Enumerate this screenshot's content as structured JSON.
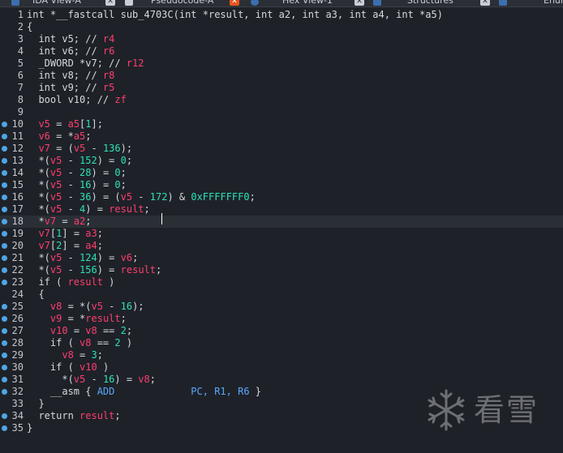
{
  "tabs": [
    {
      "label": "IDA View-A"
    },
    {
      "label": "Pseudocode-A"
    },
    {
      "label": "Hex View-1"
    },
    {
      "label": "Structures"
    },
    {
      "label": "Enum"
    }
  ],
  "code": {
    "lines": [
      {
        "n": "1",
        "bp": false,
        "t": [
          [
            "int *__fastcall sub_4703C(int *result, int a2, int a3, int a4, int *a5)",
            "k"
          ]
        ]
      },
      {
        "n": "2",
        "bp": false,
        "t": [
          [
            "{",
            "k"
          ]
        ]
      },
      {
        "n": "3",
        "bp": false,
        "t": [
          [
            "  int v5; // ",
            "k"
          ],
          [
            "r4",
            "cr"
          ]
        ]
      },
      {
        "n": "4",
        "bp": false,
        "t": [
          [
            "  int v6; // ",
            "k"
          ],
          [
            "r6",
            "cr"
          ]
        ]
      },
      {
        "n": "5",
        "bp": false,
        "t": [
          [
            "  _DWORD *v7; // ",
            "k"
          ],
          [
            "r12",
            "cr"
          ]
        ]
      },
      {
        "n": "6",
        "bp": false,
        "t": [
          [
            "  int v8; // ",
            "k"
          ],
          [
            "r8",
            "cr"
          ]
        ]
      },
      {
        "n": "7",
        "bp": false,
        "t": [
          [
            "  int v9; // ",
            "k"
          ],
          [
            "r5",
            "cr"
          ]
        ]
      },
      {
        "n": "8",
        "bp": false,
        "t": [
          [
            "  bool v10; // ",
            "k"
          ],
          [
            "zf",
            "cr"
          ]
        ]
      },
      {
        "n": "9",
        "bp": false,
        "t": [
          [
            "",
            "k"
          ]
        ]
      },
      {
        "n": "10",
        "bp": true,
        "t": [
          [
            "  ",
            "k"
          ],
          [
            "v5",
            "v"
          ],
          [
            " = ",
            "k"
          ],
          [
            "a5",
            "v"
          ],
          [
            "[",
            "k"
          ],
          [
            "1",
            "n"
          ],
          [
            "];",
            "k"
          ]
        ]
      },
      {
        "n": "11",
        "bp": true,
        "t": [
          [
            "  ",
            "k"
          ],
          [
            "v6",
            "v"
          ],
          [
            " = *",
            "k"
          ],
          [
            "a5",
            "v"
          ],
          [
            ";",
            "k"
          ]
        ]
      },
      {
        "n": "12",
        "bp": true,
        "t": [
          [
            "  ",
            "k"
          ],
          [
            "v7",
            "v"
          ],
          [
            " = (",
            "k"
          ],
          [
            "v5",
            "v"
          ],
          [
            " - ",
            "k"
          ],
          [
            "136",
            "n"
          ],
          [
            ");",
            "k"
          ]
        ]
      },
      {
        "n": "13",
        "bp": true,
        "t": [
          [
            "  *(",
            "k"
          ],
          [
            "v5",
            "v"
          ],
          [
            " - ",
            "k"
          ],
          [
            "152",
            "n"
          ],
          [
            ") = ",
            "k"
          ],
          [
            "0",
            "n"
          ],
          [
            ";",
            "k"
          ]
        ]
      },
      {
        "n": "14",
        "bp": true,
        "t": [
          [
            "  *(",
            "k"
          ],
          [
            "v5",
            "v"
          ],
          [
            " - ",
            "k"
          ],
          [
            "28",
            "n"
          ],
          [
            ") = ",
            "k"
          ],
          [
            "0",
            "n"
          ],
          [
            ";",
            "k"
          ]
        ]
      },
      {
        "n": "15",
        "bp": true,
        "t": [
          [
            "  *(",
            "k"
          ],
          [
            "v5",
            "v"
          ],
          [
            " - ",
            "k"
          ],
          [
            "16",
            "n"
          ],
          [
            ") = ",
            "k"
          ],
          [
            "0",
            "n"
          ],
          [
            ";",
            "k"
          ]
        ]
      },
      {
        "n": "16",
        "bp": true,
        "t": [
          [
            "  *(",
            "k"
          ],
          [
            "v5",
            "v"
          ],
          [
            " - ",
            "k"
          ],
          [
            "36",
            "n"
          ],
          [
            ") = (",
            "k"
          ],
          [
            "v5",
            "v"
          ],
          [
            " - ",
            "k"
          ],
          [
            "172",
            "n"
          ],
          [
            ") & ",
            "k"
          ],
          [
            "0xFFFFFFF0",
            "n"
          ],
          [
            ";",
            "k"
          ]
        ]
      },
      {
        "n": "17",
        "bp": true,
        "t": [
          [
            "  *(",
            "k"
          ],
          [
            "v5",
            "v"
          ],
          [
            " - ",
            "k"
          ],
          [
            "4",
            "n"
          ],
          [
            ") = ",
            "k"
          ],
          [
            "result",
            "v"
          ],
          [
            ";",
            "k"
          ]
        ]
      },
      {
        "n": "18",
        "bp": true,
        "current": true,
        "t": [
          [
            "  *",
            "k"
          ],
          [
            "v7",
            "v"
          ],
          [
            " = ",
            "k"
          ],
          [
            "a2",
            "v"
          ],
          [
            ";",
            "k"
          ]
        ]
      },
      {
        "n": "19",
        "bp": true,
        "t": [
          [
            "  ",
            "k"
          ],
          [
            "v7",
            "v"
          ],
          [
            "[",
            "k"
          ],
          [
            "1",
            "n"
          ],
          [
            "] = ",
            "k"
          ],
          [
            "a3",
            "v"
          ],
          [
            ";",
            "k"
          ]
        ]
      },
      {
        "n": "20",
        "bp": true,
        "t": [
          [
            "  ",
            "k"
          ],
          [
            "v7",
            "v"
          ],
          [
            "[",
            "k"
          ],
          [
            "2",
            "n"
          ],
          [
            "] = ",
            "k"
          ],
          [
            "a4",
            "v"
          ],
          [
            ";",
            "k"
          ]
        ]
      },
      {
        "n": "21",
        "bp": true,
        "t": [
          [
            "  *(",
            "k"
          ],
          [
            "v5",
            "v"
          ],
          [
            " - ",
            "k"
          ],
          [
            "124",
            "n"
          ],
          [
            ") = ",
            "k"
          ],
          [
            "v6",
            "v"
          ],
          [
            ";",
            "k"
          ]
        ]
      },
      {
        "n": "22",
        "bp": true,
        "t": [
          [
            "  *(",
            "k"
          ],
          [
            "v5",
            "v"
          ],
          [
            " - ",
            "k"
          ],
          [
            "156",
            "n"
          ],
          [
            ") = ",
            "k"
          ],
          [
            "result",
            "v"
          ],
          [
            ";",
            "k"
          ]
        ]
      },
      {
        "n": "23",
        "bp": true,
        "t": [
          [
            "  if ( ",
            "k"
          ],
          [
            "result",
            "v"
          ],
          [
            " )",
            "k"
          ]
        ]
      },
      {
        "n": "24",
        "bp": false,
        "t": [
          [
            "  {",
            "k"
          ]
        ]
      },
      {
        "n": "25",
        "bp": true,
        "t": [
          [
            "    ",
            "k"
          ],
          [
            "v8",
            "v"
          ],
          [
            " = *(",
            "k"
          ],
          [
            "v5",
            "v"
          ],
          [
            " - ",
            "k"
          ],
          [
            "16",
            "n"
          ],
          [
            ");",
            "k"
          ]
        ]
      },
      {
        "n": "26",
        "bp": true,
        "t": [
          [
            "    ",
            "k"
          ],
          [
            "v9",
            "v"
          ],
          [
            " = *",
            "k"
          ],
          [
            "result",
            "v"
          ],
          [
            ";",
            "k"
          ]
        ]
      },
      {
        "n": "27",
        "bp": true,
        "t": [
          [
            "    ",
            "k"
          ],
          [
            "v10",
            "v"
          ],
          [
            " = ",
            "k"
          ],
          [
            "v8",
            "v"
          ],
          [
            " == ",
            "k"
          ],
          [
            "2",
            "n"
          ],
          [
            ";",
            "k"
          ]
        ]
      },
      {
        "n": "28",
        "bp": true,
        "t": [
          [
            "    if ( ",
            "k"
          ],
          [
            "v8",
            "v"
          ],
          [
            " == ",
            "k"
          ],
          [
            "2",
            "n"
          ],
          [
            " )",
            "k"
          ]
        ]
      },
      {
        "n": "29",
        "bp": true,
        "t": [
          [
            "      ",
            "k"
          ],
          [
            "v8",
            "v"
          ],
          [
            " = ",
            "k"
          ],
          [
            "3",
            "n"
          ],
          [
            ";",
            "k"
          ]
        ]
      },
      {
        "n": "30",
        "bp": true,
        "t": [
          [
            "    if ( ",
            "k"
          ],
          [
            "v10",
            "v"
          ],
          [
            " )",
            "k"
          ]
        ]
      },
      {
        "n": "31",
        "bp": true,
        "t": [
          [
            "      *(",
            "k"
          ],
          [
            "v5",
            "v"
          ],
          [
            " - ",
            "k"
          ],
          [
            "16",
            "n"
          ],
          [
            ") = ",
            "k"
          ],
          [
            "v8",
            "v"
          ],
          [
            ";",
            "k"
          ]
        ]
      },
      {
        "n": "32",
        "bp": true,
        "t": [
          [
            "    __asm { ",
            "k"
          ],
          [
            "ADD             PC, R1, R6",
            "a"
          ],
          [
            " }",
            "k"
          ]
        ]
      },
      {
        "n": "33",
        "bp": false,
        "t": [
          [
            "  }",
            "k"
          ]
        ]
      },
      {
        "n": "34",
        "bp": true,
        "t": [
          [
            "  return ",
            "k"
          ],
          [
            "result",
            "v"
          ],
          [
            ";",
            "k"
          ]
        ]
      },
      {
        "n": "35",
        "bp": true,
        "t": [
          [
            "}",
            "k"
          ]
        ]
      }
    ]
  },
  "watermark": {
    "text": "看雪",
    "icon": "snowflake-icon"
  },
  "colors": {
    "keyword": "#d6d9dd",
    "variable": "#ff3d6e",
    "number": "#2ee0b6",
    "asm": "#5aa7ff",
    "breakpoint": "#4ea6e6",
    "background": "#1e2228"
  }
}
